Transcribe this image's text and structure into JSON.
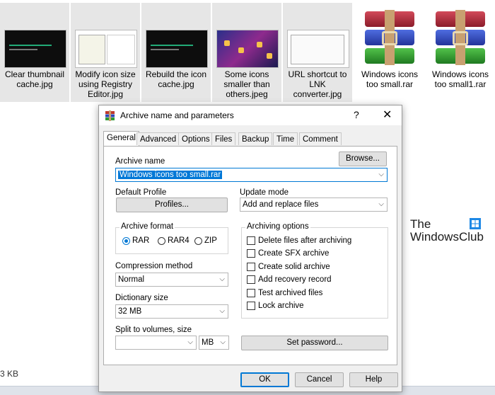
{
  "explorer": {
    "files": [
      {
        "label": "Clear thumbnail cache.jpg"
      },
      {
        "label": "Modify icon size using Registry Editor.jpg"
      },
      {
        "label": "Rebuild the icon cache.jpg"
      },
      {
        "label": "Some icons smaller than others.jpeg"
      },
      {
        "label": "URL shortcut to LNK converter.jpg"
      },
      {
        "label": "Windows icons too small.rar"
      },
      {
        "label": "Windows icons too small1.rar"
      }
    ],
    "status_size": "3 KB"
  },
  "watermark": {
    "line1": "The",
    "line2": "WindowsClub"
  },
  "dialog": {
    "title": "Archive name and parameters",
    "help_glyph": "?",
    "close_glyph": "✕",
    "tabs": [
      "General",
      "Advanced",
      "Options",
      "Files",
      "Backup",
      "Time",
      "Comment"
    ],
    "active_tab": "General",
    "archive_name_label": "Archive name",
    "browse_label": "Browse...",
    "archive_name_value": "Windows icons too small.rar",
    "default_profile_label": "Default Profile",
    "profiles_label": "Profiles...",
    "update_mode_label": "Update mode",
    "update_mode_value": "Add and replace files",
    "archive_format_label": "Archive format",
    "formats": [
      "RAR",
      "RAR4",
      "ZIP"
    ],
    "selected_format": "RAR",
    "archiving_options_label": "Archiving options",
    "options": [
      {
        "label": "Delete files after archiving",
        "checked": false
      },
      {
        "label": "Create SFX archive",
        "checked": false
      },
      {
        "label": "Create solid archive",
        "checked": false
      },
      {
        "label": "Add recovery record",
        "checked": false
      },
      {
        "label": "Test archived files",
        "checked": false
      },
      {
        "label": "Lock archive",
        "checked": false
      }
    ],
    "compression_method_label": "Compression method",
    "compression_method_value": "Normal",
    "dictionary_size_label": "Dictionary size",
    "dictionary_size_value": "32 MB",
    "split_label": "Split to volumes, size",
    "split_value": "",
    "split_unit": "MB",
    "set_password_label": "Set password...",
    "ok_label": "OK",
    "cancel_label": "Cancel",
    "help_label": "Help"
  },
  "colors": {
    "accent": "#0078d4",
    "selection": "#0078d7"
  }
}
